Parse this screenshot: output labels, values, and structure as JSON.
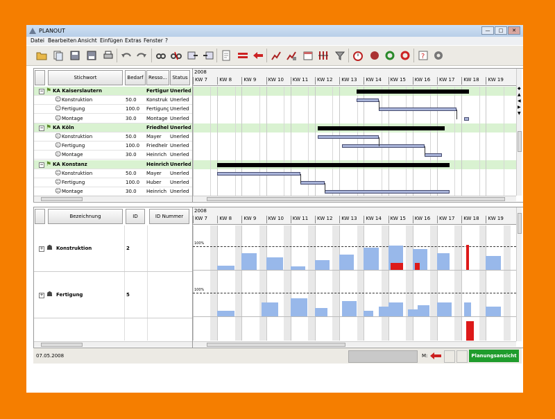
{
  "window": {
    "title": "PLANOUT",
    "buttons": {
      "minimize": "—",
      "maximize": "□",
      "close": "✕"
    }
  },
  "menu": [
    "Datei",
    "Bearbeiten",
    "Ansicht",
    "Einfügen",
    "Extras",
    "Fenster",
    "?"
  ],
  "toolbar": {
    "icons": [
      "open-icon",
      "copy-icon",
      "save-icon",
      "save-as-icon",
      "print-icon",
      "undo-icon",
      "redo-icon",
      "link-icon",
      "unlink-icon",
      "import-icon",
      "export-icon",
      "page-icon",
      "bars-icon",
      "arrow-left-icon",
      "chart-icon",
      "chart-edit-icon",
      "calendar-icon",
      "columns-icon",
      "filter-icon",
      "stopwatch-icon",
      "record-icon",
      "refresh-green-icon",
      "refresh-red-icon",
      "help-icon",
      "settings-icon"
    ]
  },
  "upper": {
    "headers": {
      "name": "Stichwort",
      "demand": "Bedarf",
      "resource": "Resso...",
      "status": "Status"
    },
    "year": "2008",
    "weeks": [
      "KW 7",
      "KW 8",
      "KW 9",
      "KW 10",
      "KW 11",
      "KW 12",
      "KW 13",
      "KW 14",
      "KW 15",
      "KW 16",
      "KW 17",
      "KW 18",
      "KW 19"
    ],
    "rows": [
      {
        "type": "summary",
        "name": "KA Kaiserslautern",
        "demand": "",
        "resource": "Fertigung",
        "status": "Unerled"
      },
      {
        "type": "task",
        "name": "Konstruktion",
        "demand": "50.0",
        "resource": "Konstruk",
        "status": "Unerled"
      },
      {
        "type": "task",
        "name": "Fertigung",
        "demand": "100.0",
        "resource": "Fertigung",
        "status": "Unerled"
      },
      {
        "type": "task",
        "name": "Montage",
        "demand": "30.0",
        "resource": "Montage",
        "status": "Unerled"
      },
      {
        "type": "summary",
        "name": "KA Köln",
        "demand": "",
        "resource": "Friedhelr",
        "status": "Unerled"
      },
      {
        "type": "task",
        "name": "Konstruktion",
        "demand": "50.0",
        "resource": "Mayer",
        "status": "Unerled"
      },
      {
        "type": "task",
        "name": "Fertigung",
        "demand": "100.0",
        "resource": "Friedhelr",
        "status": "Unerled"
      },
      {
        "type": "task",
        "name": "Montage",
        "demand": "30.0",
        "resource": "Heinrich",
        "status": "Unerled"
      },
      {
        "type": "summary",
        "name": "KA Konstanz",
        "demand": "",
        "resource": "Heinrich",
        "status": "Unerled"
      },
      {
        "type": "task",
        "name": "Konstruktion",
        "demand": "50.0",
        "resource": "Mayer",
        "status": "Unerled"
      },
      {
        "type": "task",
        "name": "Fertigung",
        "demand": "100.0",
        "resource": "Huber",
        "status": "Unerled"
      },
      {
        "type": "task",
        "name": "Montage",
        "demand": "30.0",
        "resource": "Heinrich",
        "status": "Unerled"
      }
    ]
  },
  "lower": {
    "headers": {
      "name": "Bezeichnung",
      "id": "ID",
      "idnum": "ID Nummer"
    },
    "year": "2008",
    "rows": [
      {
        "name": "Konstruktion",
        "id": "2",
        "cap_label": "100%"
      },
      {
        "name": "Fertigung",
        "id": "5",
        "cap_label": "100%"
      }
    ]
  },
  "status": {
    "date": "07.05.2008",
    "mode_label": "M:",
    "view_button": "Planungsansicht"
  },
  "colors": {
    "summary_row": "#d9f2d1",
    "task_bar": "#a9b4d9",
    "load_bar": "#98b8ea",
    "overload": "#dd1a1a",
    "view_button": "#1f9c2c"
  }
}
